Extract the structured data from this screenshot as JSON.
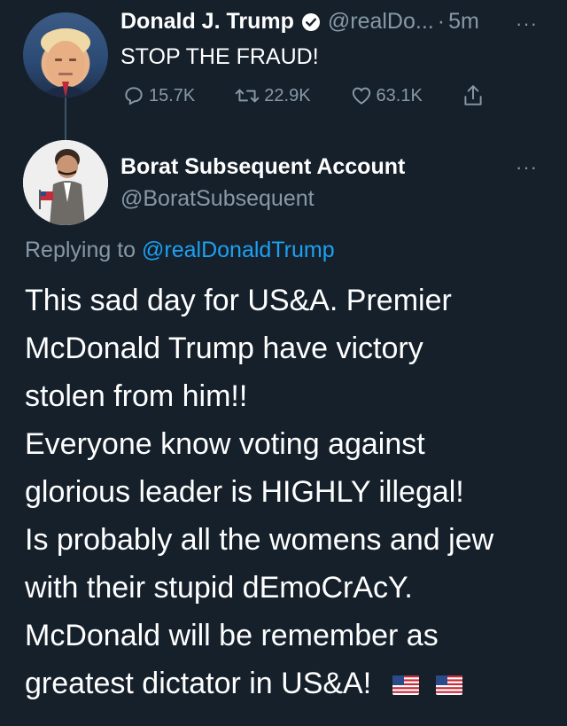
{
  "tweet1": {
    "name": "Donald J. Trump",
    "handle": "@realDo...",
    "dot": "·",
    "time": "5m",
    "more": "···",
    "text": "STOP THE FRAUD!",
    "actions": {
      "replies": "15.7K",
      "retweets": "22.9K",
      "likes": "63.1K"
    },
    "icons": [
      "verified-icon",
      "reply-icon",
      "retweet-icon",
      "like-icon",
      "share-icon"
    ]
  },
  "tweet2": {
    "name": "Borat Subsequent Account",
    "handle": "@BoratSubsequent",
    "more": "···",
    "replying_prefix": "Replying to",
    "replying_handle": "@realDonaldTrump",
    "lines": [
      "This sad day for US&A. Premier",
      "McDonald Trump have victory",
      "stolen from him!!",
      "Everyone know voting against",
      "glorious leader is HIGHLY illegal!",
      "Is probably all the womens and jew",
      "with their stupid dEmoCrAcY.",
      "McDonald will be remember as",
      "greatest dictator in US&A!"
    ],
    "emoji": [
      "us-flag-icon",
      "us-flag-icon"
    ]
  },
  "colors": {
    "background": "#15202b",
    "muted": "#8899a6",
    "link": "#1da1f2",
    "thread_line": "#3d5466"
  }
}
